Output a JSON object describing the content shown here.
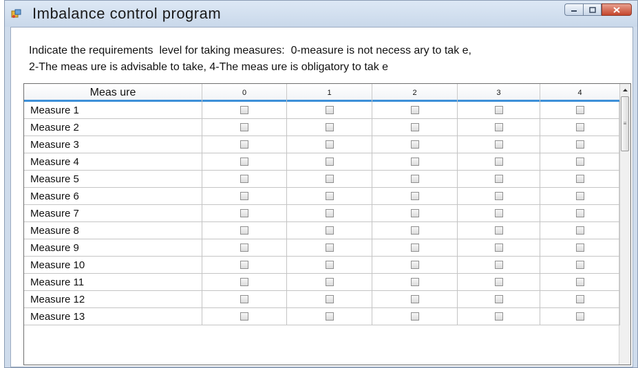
{
  "window": {
    "title": "Imbalance control program"
  },
  "instructions": {
    "line1": "Indicate the requirements  level for taking measures:  0-measure is not necess ary to tak e,",
    "line2": "2-The meas ure is advisable to take, 4-The meas ure is obligatory to tak e"
  },
  "grid": {
    "columns": [
      "Meas ure",
      "0",
      "1",
      "2",
      "3",
      "4"
    ],
    "rows": [
      {
        "name": "Measure  1",
        "checked": [
          false,
          false,
          false,
          false,
          false
        ]
      },
      {
        "name": "Measure  2",
        "checked": [
          false,
          false,
          false,
          false,
          false
        ]
      },
      {
        "name": "Measure  3",
        "checked": [
          false,
          false,
          false,
          false,
          false
        ]
      },
      {
        "name": "Measure  4",
        "checked": [
          false,
          false,
          false,
          false,
          false
        ]
      },
      {
        "name": "Measure  5",
        "checked": [
          false,
          false,
          false,
          false,
          false
        ]
      },
      {
        "name": "Measure  6",
        "checked": [
          false,
          false,
          false,
          false,
          false
        ]
      },
      {
        "name": "Measure  7",
        "checked": [
          false,
          false,
          false,
          false,
          false
        ]
      },
      {
        "name": "Measure  8",
        "checked": [
          false,
          false,
          false,
          false,
          false
        ]
      },
      {
        "name": "Measure  9",
        "checked": [
          false,
          false,
          false,
          false,
          false
        ]
      },
      {
        "name": "Measure  10",
        "checked": [
          false,
          false,
          false,
          false,
          false
        ]
      },
      {
        "name": "Measure  11",
        "checked": [
          false,
          false,
          false,
          false,
          false
        ]
      },
      {
        "name": "Measure  12",
        "checked": [
          false,
          false,
          false,
          false,
          false
        ]
      },
      {
        "name": "Measure  13",
        "checked": [
          false,
          false,
          false,
          false,
          false
        ]
      }
    ]
  }
}
